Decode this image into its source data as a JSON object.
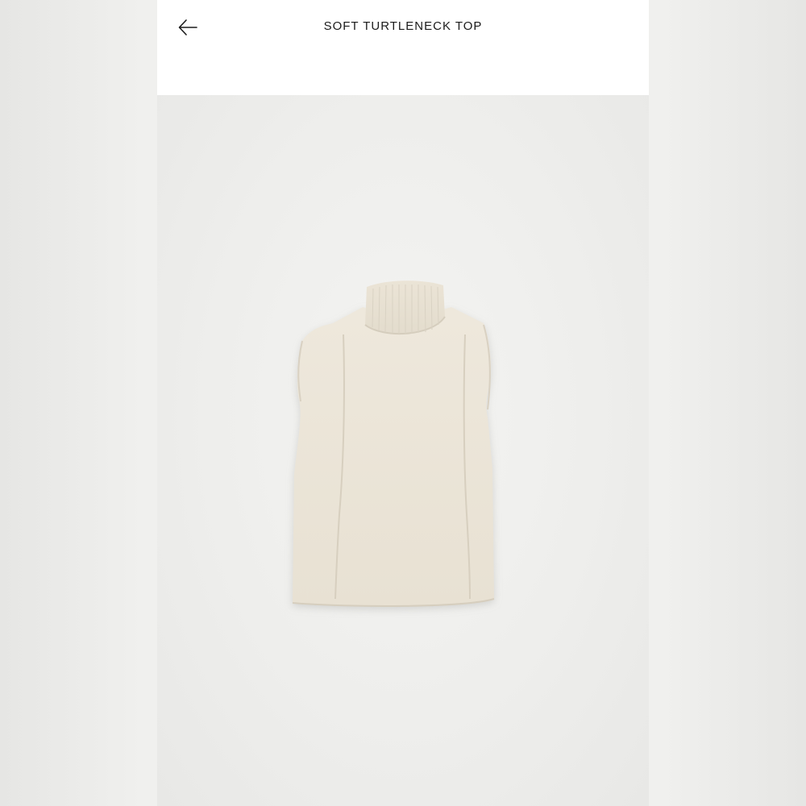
{
  "header": {
    "title": "SOFT TURTLENECK TOP",
    "back_icon": "arrow-left-icon"
  },
  "product_image": {
    "subject": "sleeveless-turtleneck-knit-top",
    "colors": {
      "garment": "#ede7da",
      "background": "#eeeeec"
    }
  }
}
